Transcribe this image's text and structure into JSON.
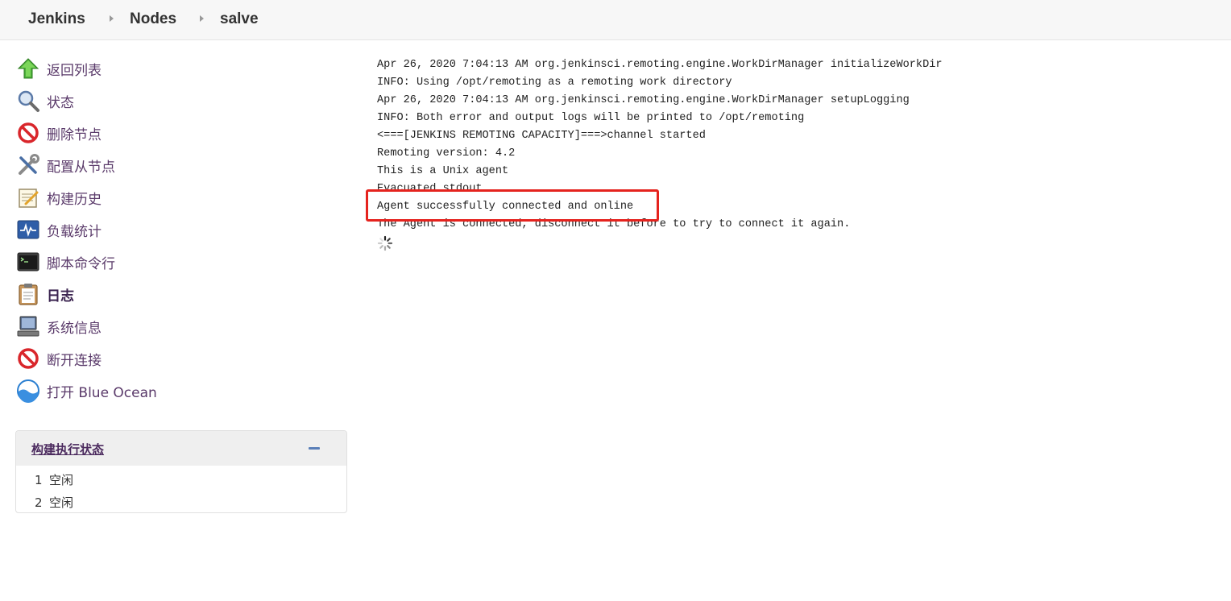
{
  "breadcrumb": {
    "items": [
      "Jenkins",
      "Nodes",
      "salve"
    ]
  },
  "sidebar": {
    "tasks": [
      {
        "label": "返回列表",
        "icon": "up-arrow-icon"
      },
      {
        "label": "状态",
        "icon": "search-icon"
      },
      {
        "label": "删除节点",
        "icon": "no-entry-icon"
      },
      {
        "label": "配置从节点",
        "icon": "tools-icon"
      },
      {
        "label": "构建历史",
        "icon": "notepad-icon"
      },
      {
        "label": "负载统计",
        "icon": "monitor-chart-icon"
      },
      {
        "label": "脚本命令行",
        "icon": "terminal-icon"
      },
      {
        "label": "日志",
        "icon": "clipboard-icon"
      },
      {
        "label": "系统信息",
        "icon": "computer-icon"
      },
      {
        "label": "断开连接",
        "icon": "no-entry-icon"
      },
      {
        "label": "打开 Blue Ocean",
        "icon": "blue-ocean-icon"
      }
    ]
  },
  "executors": {
    "title": "构建执行状态",
    "rows": [
      {
        "num": "1",
        "status": "空闲"
      },
      {
        "num": "2",
        "status": "空闲"
      }
    ]
  },
  "console": {
    "lines": [
      "Apr 26, 2020 7:04:13 AM org.jenkinsci.remoting.engine.WorkDirManager initializeWorkDir",
      "INFO: Using /opt/remoting as a remoting work directory",
      "Apr 26, 2020 7:04:13 AM org.jenkinsci.remoting.engine.WorkDirManager setupLogging",
      "INFO: Both error and output logs will be printed to /opt/remoting",
      "<===[JENKINS REMOTING CAPACITY]===>channel started",
      "Remoting version: 4.2",
      "This is a Unix agent",
      "Evacuated stdout",
      "Agent successfully connected and online",
      "The Agent is connected, disconnect it before to try to connect it again."
    ]
  },
  "colors": {
    "highlight": "#e5231e",
    "link": "#5a3a6a"
  }
}
